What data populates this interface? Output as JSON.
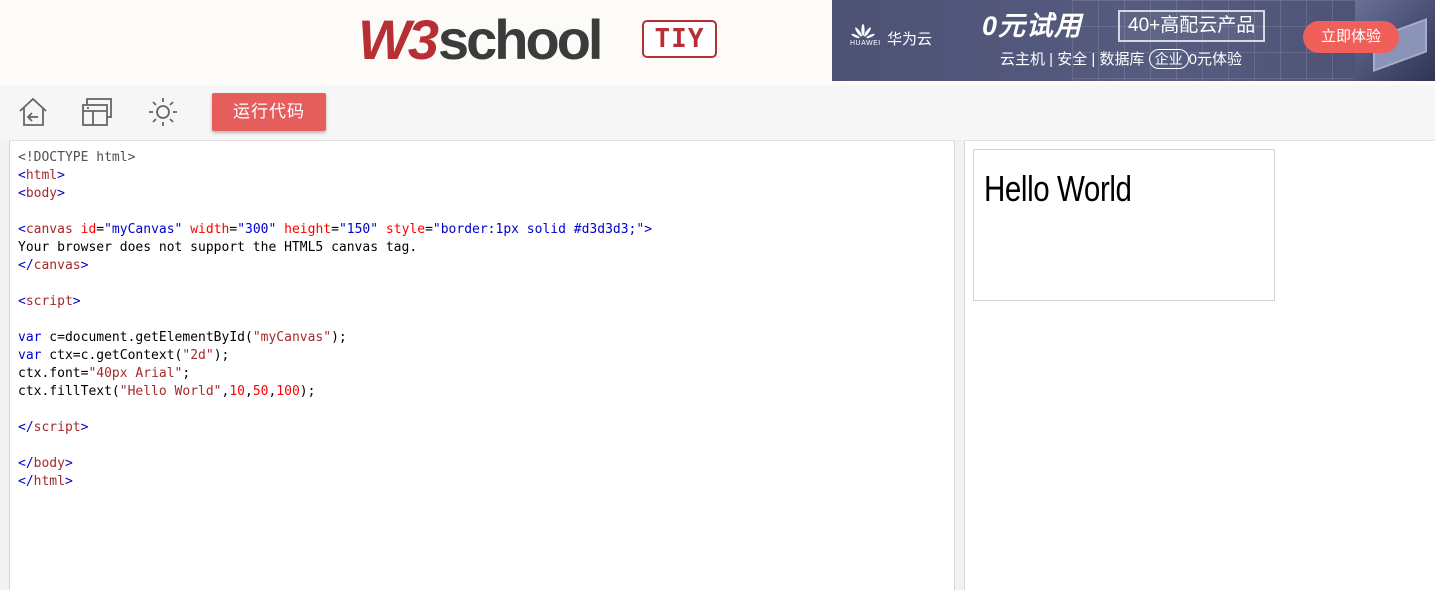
{
  "header": {
    "logo_w3": "W3",
    "logo_school": "school",
    "badge": "TIY"
  },
  "ad": {
    "huawei_small": "HUAWEI",
    "brand": "华为云",
    "headline": "0元试用",
    "bracket": "40+高配云产品",
    "sub_left": "云主机 | 安全 | 数据库",
    "sub_circle": "企业",
    "sub_right": "0元体验",
    "cta": "立即体验"
  },
  "toolbar": {
    "home_icon": "home-back-icon",
    "layout_icon": "layout-window-icon",
    "theme_icon": "sun-theme-icon",
    "run_label": "运行代码"
  },
  "code": {
    "lines": [
      [
        {
          "c": "doc",
          "t": "<!DOCTYPE html>"
        }
      ],
      [
        {
          "c": "br",
          "t": "<"
        },
        {
          "c": "tag",
          "t": "html"
        },
        {
          "c": "br",
          "t": ">"
        }
      ],
      [
        {
          "c": "br",
          "t": "<"
        },
        {
          "c": "tag",
          "t": "body"
        },
        {
          "c": "br",
          "t": ">"
        }
      ],
      [],
      [
        {
          "c": "br",
          "t": "<"
        },
        {
          "c": "tag",
          "t": "canvas"
        },
        {
          "c": "text",
          "t": " "
        },
        {
          "c": "attr",
          "t": "id"
        },
        {
          "c": "text",
          "t": "="
        },
        {
          "c": "val",
          "t": "\"myCanvas\""
        },
        {
          "c": "text",
          "t": " "
        },
        {
          "c": "attr",
          "t": "width"
        },
        {
          "c": "text",
          "t": "="
        },
        {
          "c": "val",
          "t": "\"300\""
        },
        {
          "c": "text",
          "t": " "
        },
        {
          "c": "attr",
          "t": "height"
        },
        {
          "c": "text",
          "t": "="
        },
        {
          "c": "val",
          "t": "\"150\""
        },
        {
          "c": "text",
          "t": " "
        },
        {
          "c": "attr",
          "t": "style"
        },
        {
          "c": "text",
          "t": "="
        },
        {
          "c": "val",
          "t": "\"border:1px solid #d3d3d3;\""
        },
        {
          "c": "br",
          "t": ">"
        }
      ],
      [
        {
          "c": "text",
          "t": "Your browser does not support the HTML5 canvas tag."
        }
      ],
      [
        {
          "c": "br",
          "t": "</"
        },
        {
          "c": "tag",
          "t": "canvas"
        },
        {
          "c": "br",
          "t": ">"
        }
      ],
      [],
      [
        {
          "c": "br",
          "t": "<"
        },
        {
          "c": "tag",
          "t": "script"
        },
        {
          "c": "br",
          "t": ">"
        }
      ],
      [],
      [
        {
          "c": "kw",
          "t": "var"
        },
        {
          "c": "text",
          "t": " c=document.getElementById("
        },
        {
          "c": "str",
          "t": "\"myCanvas\""
        },
        {
          "c": "text",
          "t": ");"
        }
      ],
      [
        {
          "c": "kw",
          "t": "var"
        },
        {
          "c": "text",
          "t": " ctx=c.getContext("
        },
        {
          "c": "str",
          "t": "\"2d\""
        },
        {
          "c": "text",
          "t": ");"
        }
      ],
      [
        {
          "c": "text",
          "t": "ctx.font="
        },
        {
          "c": "str",
          "t": "\"40px Arial\""
        },
        {
          "c": "text",
          "t": ";"
        }
      ],
      [
        {
          "c": "text",
          "t": "ctx.fillText("
        },
        {
          "c": "str",
          "t": "\"Hello World\""
        },
        {
          "c": "text",
          "t": ","
        },
        {
          "c": "num",
          "t": "10"
        },
        {
          "c": "text",
          "t": ","
        },
        {
          "c": "num",
          "t": "50"
        },
        {
          "c": "text",
          "t": ","
        },
        {
          "c": "num",
          "t": "100"
        },
        {
          "c": "text",
          "t": ");"
        }
      ],
      [],
      [
        {
          "c": "br",
          "t": "</"
        },
        {
          "c": "tag",
          "t": "script"
        },
        {
          "c": "br",
          "t": ">"
        }
      ],
      [],
      [
        {
          "c": "br",
          "t": "</"
        },
        {
          "c": "tag",
          "t": "body"
        },
        {
          "c": "br",
          "t": ">"
        }
      ],
      [
        {
          "c": "br",
          "t": "</"
        },
        {
          "c": "tag",
          "t": "html"
        },
        {
          "c": "br",
          "t": ">"
        }
      ]
    ]
  },
  "result": {
    "canvas_text": "Hello World"
  },
  "colors": {
    "brand_red": "#b72f34",
    "run_button": "#e55e5c",
    "ad_bg": "#4d5275",
    "ad_cta": "#f15f5a"
  }
}
